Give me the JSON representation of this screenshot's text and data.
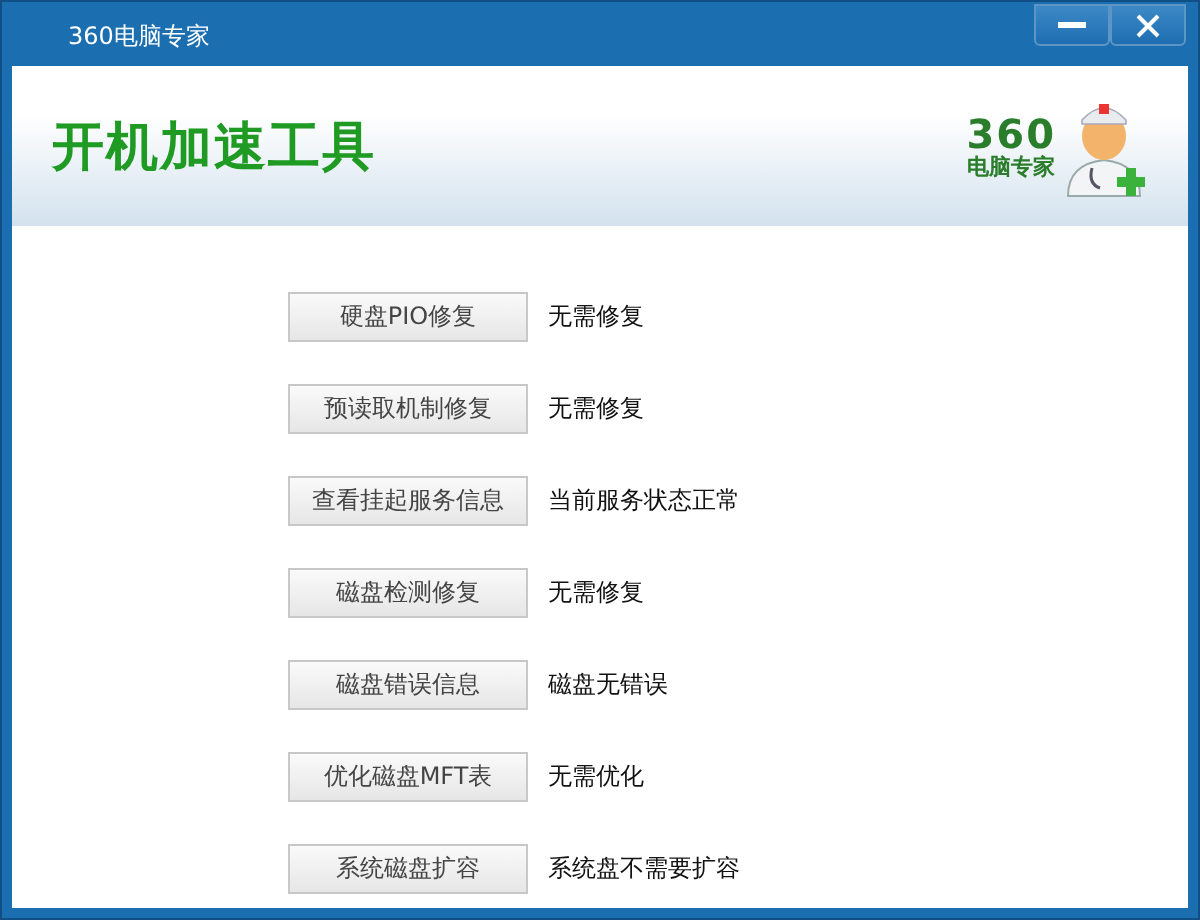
{
  "window": {
    "title": "360电脑专家",
    "controls": [
      {
        "kind": "minimize"
      },
      {
        "kind": "close"
      }
    ]
  },
  "header": {
    "title": "开机加速工具",
    "logo": {
      "number": "360",
      "name": "电脑专家"
    }
  },
  "actions": [
    {
      "button": "硬盘PIO修复",
      "status": "无需修复"
    },
    {
      "button": "预读取机制修复",
      "status": "无需修复"
    },
    {
      "button": "查看挂起服务信息",
      "status": "当前服务状态正常"
    },
    {
      "button": "磁盘检测修复",
      "status": "无需修复"
    },
    {
      "button": "磁盘错误信息",
      "status": "磁盘无错误"
    },
    {
      "button": "优化磁盘MFT表",
      "status": "无需优化"
    },
    {
      "button": "系统磁盘扩容",
      "status": "系统盘不需要扩容"
    }
  ]
}
